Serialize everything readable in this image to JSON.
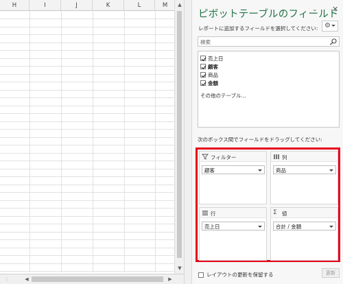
{
  "sheet": {
    "columns": [
      "H",
      "I",
      "J",
      "K",
      "L",
      "M"
    ]
  },
  "pane": {
    "title": "ピボットテーブルのフィールド",
    "subtitle": "レポートに追加するフィールドを選択してください:",
    "search_placeholder": "検索",
    "fields": [
      {
        "label": "売上日",
        "checked": true
      },
      {
        "label": "顧客",
        "checked": true
      },
      {
        "label": "商品",
        "checked": true
      },
      {
        "label": "金額",
        "checked": true
      }
    ],
    "more_tables": "その他のテーブル...",
    "drag_note": "次のボックス間でフィールドをドラッグしてください:",
    "areas": {
      "filter": {
        "title": "フィルター",
        "field": "顧客"
      },
      "columns": {
        "title": "列",
        "field": "商品"
      },
      "rows": {
        "title": "行",
        "field": "売上日"
      },
      "values": {
        "title": "値",
        "field": "合計 / 金額"
      }
    },
    "defer_label": "レイアウトの更新を保留する",
    "update_label": "更新",
    "accent_color": "#217346",
    "highlight_color": "#e8001b"
  }
}
